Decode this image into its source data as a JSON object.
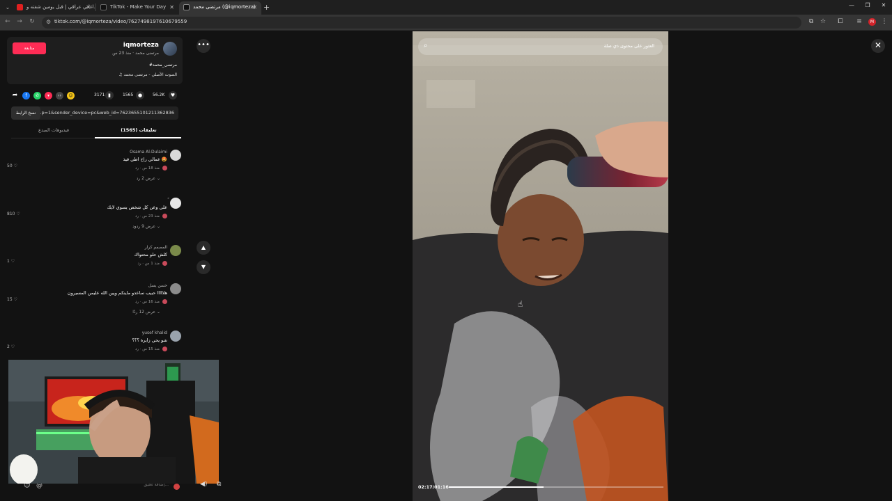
{
  "browser": {
    "tabs": [
      {
        "title": "اغاني عراقي | قبل يومين شفته و..."
      },
      {
        "title": "TikTok - Make Your Day"
      },
      {
        "title": "مرتضى محمد (@iqmorteza)"
      }
    ],
    "url": "tiktok.com/@iqmorteza/video/7627498197610679559",
    "profile_initial": "M"
  },
  "creator": {
    "handle": "iqmorteza",
    "subline": "مرتضى محمد · منذ 23 س",
    "follow_label": "متابعة",
    "hashtag": "#مرتضى_محمد",
    "music": "♫ الصوت الأصلي - مرتضى محمد"
  },
  "stats": {
    "likes": "56.2K",
    "comments": "1565",
    "saves": "3171"
  },
  "share": {
    "link": "...p=1&sender_device=pc&web_id=7623655101211362836",
    "copy_label": "نسخ الرابط"
  },
  "panel_tabs": {
    "comments": "تعليقات (1565)",
    "creator_videos": "فيديوهات المبدع"
  },
  "comments": [
    {
      "name": "Osama Al-Dulaimi",
      "text": "عمالي راح اطي قيذ 🤩",
      "meta": "منذ 18 س · رد",
      "likes": "50",
      "replies": "عرض 2 رد ⌄",
      "avatar_color": "#d9d9d9"
    },
    {
      "name": "ً",
      "text": "علي وعن كل شخص يسوي لايك",
      "meta": "منذ 23 س · رد",
      "likes": "810",
      "replies": "عرض 9 ردود ⌄",
      "avatar_color": "#e6e6e6"
    },
    {
      "name": "المصمم كرار",
      "text": "كلش حلو محتواك",
      "meta": "منذ 1 س · رد",
      "likes": "1",
      "replies": "",
      "avatar_color": "#7a8a4a"
    },
    {
      "name": "حسن يسل",
      "text": "هلااااا حبيب ساعدو ماينكم ويين الله عليمن المسيرون",
      "meta": "منذ 16 س · رد",
      "likes": "15",
      "replies": "عرض 12 ردًا ⌄",
      "avatar_color": "#8b8b8b"
    },
    {
      "name": "yusef khalid",
      "text": "شو يحي زايرة ؟؟؟",
      "meta": "منذ 15 س · رد",
      "likes": "2",
      "replies": "",
      "avatar_color": "#9aa3ad"
    }
  ],
  "comment_input_placeholder": "إضافة تعليق...",
  "video": {
    "search_placeholder": "العثور على محتوى ذي صلة",
    "time": "02:17/01:16",
    "progress": 0.44
  },
  "icons": {
    "like": "heart-icon",
    "comment": "comment-icon",
    "save": "bookmark-icon",
    "close": "close-icon",
    "more": "more-icon",
    "up": "chevron-up-icon",
    "down": "chevron-down-icon"
  }
}
